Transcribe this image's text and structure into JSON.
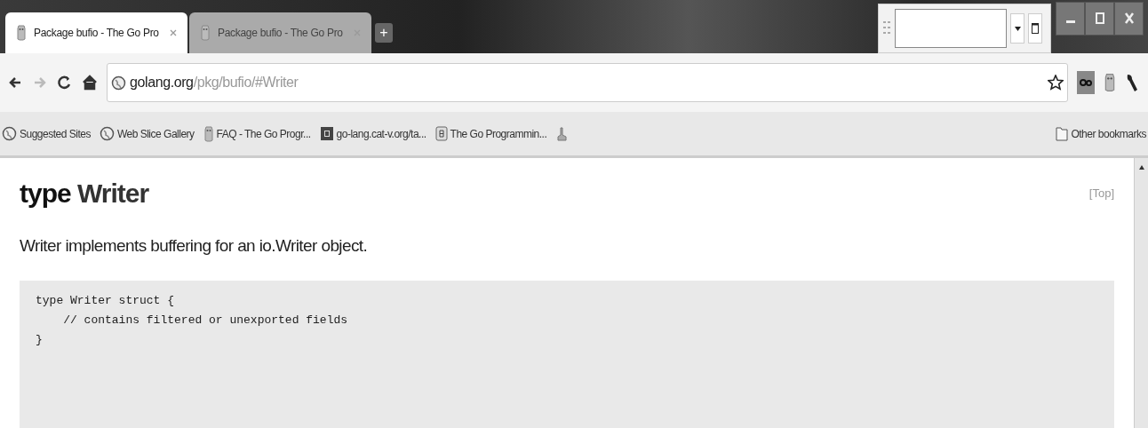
{
  "tabs": [
    {
      "title": "Package bufio - The Go Pro",
      "selected": true
    },
    {
      "title": "Package bufio - The Go Pro",
      "selected": false
    }
  ],
  "new_tab_button": "+",
  "address": {
    "host": "golang.org",
    "path": "/pkg/bufio/#Writer"
  },
  "bookmarks": [
    {
      "label": "Suggested Sites",
      "kind": "globe"
    },
    {
      "label": "Web Slice Gallery",
      "kind": "globe"
    },
    {
      "label": "FAQ - The Go Progr...",
      "kind": "gopher"
    },
    {
      "label": "go-lang.cat-v.org/ta...",
      "kind": "page"
    },
    {
      "label": "The Go Programmin...",
      "kind": "doc"
    },
    {
      "kind": "figure"
    }
  ],
  "other_bookmarks": "Other bookmarks",
  "page": {
    "heading_keyword": "type",
    "heading_name": "Writer",
    "top_link": "[Top]",
    "description": "Writer implements buffering for an io.Writer object.",
    "code_lines": [
      "type Writer struct {",
      "    // contains filtered or unexported fields",
      "}"
    ]
  }
}
